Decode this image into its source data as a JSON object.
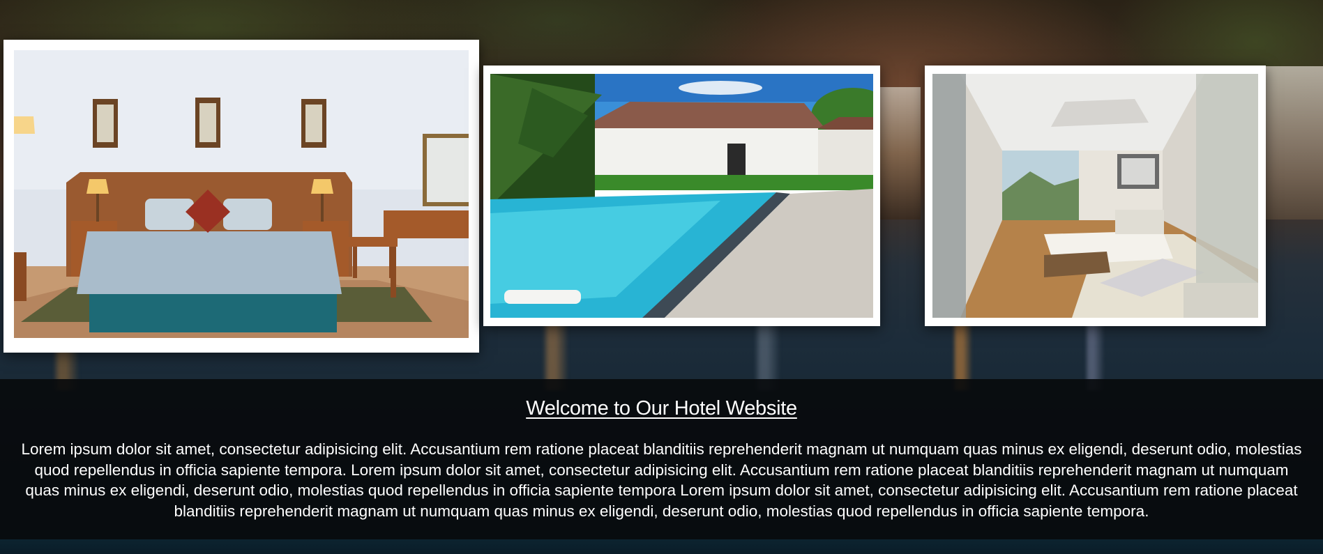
{
  "gallery": {
    "photos": [
      {
        "subject": "bedroom"
      },
      {
        "subject": "pool"
      },
      {
        "subject": "suite"
      }
    ]
  },
  "welcome": {
    "title": "Welcome to Our Hotel Website",
    "body": "Lorem ipsum dolor sit amet, consectetur adipisicing elit. Accusantium rem ratione placeat blanditiis reprehenderit magnam ut numquam quas minus ex eligendi, deserunt odio, molestias quod repellendus in officia sapiente tempora. Lorem ipsum dolor sit amet, consectetur adipisicing elit. Accusantium rem ratione placeat blanditiis reprehenderit magnam ut numquam quas minus ex eligendi, deserunt odio, molestias quod repellendus in officia sapiente tempora Lorem ipsum dolor sit amet, consectetur adipisicing elit. Accusantium rem ratione placeat blanditiis reprehenderit magnam ut numquam quas minus ex eligendi, deserunt odio, molestias quod repellendus in officia sapiente tempora."
  },
  "colors": {
    "panel_background": "#08090c",
    "title_text": "#ffffff",
    "body_text": "#ffffff",
    "frame_border": "#ffffff"
  }
}
